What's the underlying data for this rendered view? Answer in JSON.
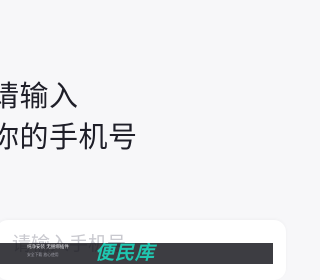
{
  "login": {
    "heading_line1": "请输入",
    "heading_line2": "你的手机号",
    "phone_placeholder": "请输入手机号"
  },
  "watermark": {
    "tagline": "纯净安装  无捆绑插件",
    "sub": "安全下载  放心使用",
    "logo_text": "便民库"
  },
  "colors": {
    "background": "#f7f7f9",
    "heading": "#1e1e28",
    "placeholder": "#c9c9cf",
    "watermark_logo": "#1fc7b0"
  }
}
